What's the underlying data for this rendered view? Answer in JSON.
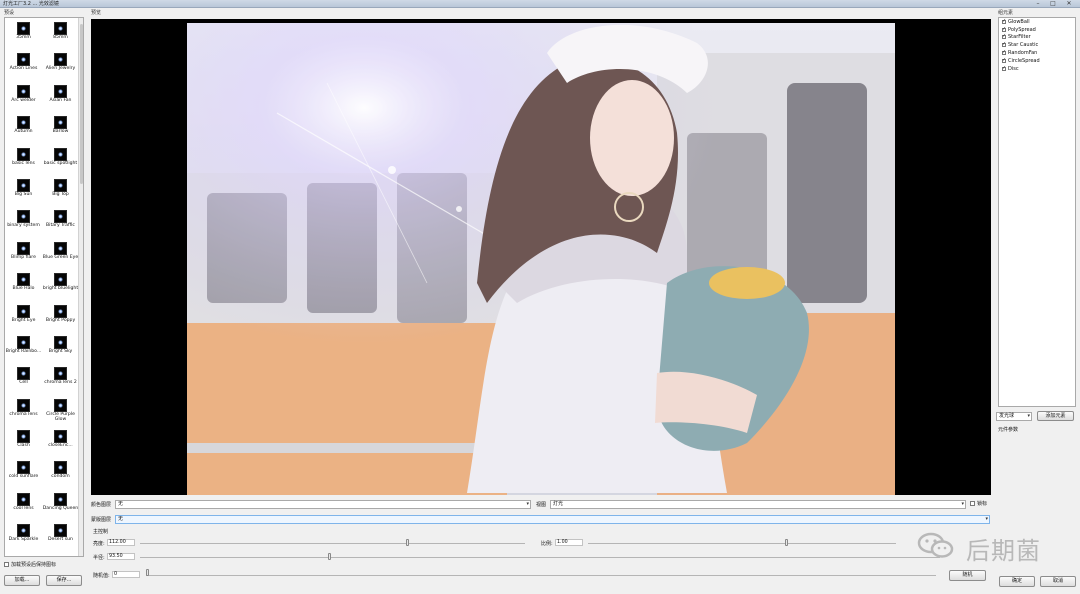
{
  "window": {
    "title": "灯光工厂3.2 ... 光效滤镜",
    "min_label": "–",
    "max_label": "□",
    "close_label": "✕"
  },
  "sections": {
    "presets": "预设",
    "preview": "预览",
    "layers": "组元素"
  },
  "presets": [
    {
      "label": "35mm"
    },
    {
      "label": "85mm"
    },
    {
      "label": "Action Lines"
    },
    {
      "label": "Alien Jewelry"
    },
    {
      "label": "Arc welder"
    },
    {
      "label": "Asian Fan"
    },
    {
      "label": "Autumn"
    },
    {
      "label": "Barlow"
    },
    {
      "label": "basic lens"
    },
    {
      "label": "basic spotlight"
    },
    {
      "label": "Big Sun"
    },
    {
      "label": "Big Top"
    },
    {
      "label": "binary system"
    },
    {
      "label": "Bitary Traffic"
    },
    {
      "label": "Blimp flare"
    },
    {
      "label": "Blue Green Eye"
    },
    {
      "label": "Blue Halo"
    },
    {
      "label": "bright bluelight"
    },
    {
      "label": "Bright Eye"
    },
    {
      "label": "Bright Poppy"
    },
    {
      "label": "Bright Rainbo..."
    },
    {
      "label": "Bright Sky"
    },
    {
      "label": "Cell"
    },
    {
      "label": "chroma lens 2"
    },
    {
      "label": "chroma lens"
    },
    {
      "label": "Circle Purple Glow"
    },
    {
      "label": "Clash"
    },
    {
      "label": "closeEnc..."
    },
    {
      "label": "cold sunflare"
    },
    {
      "label": "condom"
    },
    {
      "label": "cool lens"
    },
    {
      "label": "Dancing Queen"
    },
    {
      "label": "Dark Sparkle"
    },
    {
      "label": "Desert sun"
    }
  ],
  "left_footer": {
    "checkbox_label": "加载预设后保持图标",
    "load_button": "加载...",
    "save_button": "保存..."
  },
  "layers": [
    {
      "label": "GlowBall",
      "checked": true
    },
    {
      "label": "PolySpread",
      "checked": true
    },
    {
      "label": "StarFilter",
      "checked": true
    },
    {
      "label": "Star Caustic",
      "checked": true
    },
    {
      "label": "RandomFan",
      "checked": true
    },
    {
      "label": "CircleSpread",
      "checked": true
    },
    {
      "label": "Disc",
      "checked": true
    }
  ],
  "right_controls": {
    "type_select": "发光球",
    "add_element_button": "添加元素",
    "element_params_label": "元件参数"
  },
  "bottom": {
    "color_label": "颜色图层",
    "color_value": "无",
    "view_label": "视图",
    "view_value": "灯光",
    "lock_label": "锁标",
    "mask_label": "蒙版图层",
    "mask_value": "无",
    "main_control_label": "主控制",
    "brightness_label": "亮度:",
    "brightness_value": "112.00",
    "scale_label": "比例:",
    "scale_value": "1.00",
    "radius_label": "半径:",
    "radius_value": "93.50",
    "random_label": "随机值:",
    "random_value": "0",
    "random_button": "随机",
    "ok_button": "确定",
    "cancel_button": "取消"
  },
  "sliders": {
    "brightness": 0.69,
    "scale": 0.64,
    "radius": 0.47,
    "random": 0.0
  },
  "watermark": {
    "text": "后期菌",
    "icon": "wechat-icon"
  }
}
